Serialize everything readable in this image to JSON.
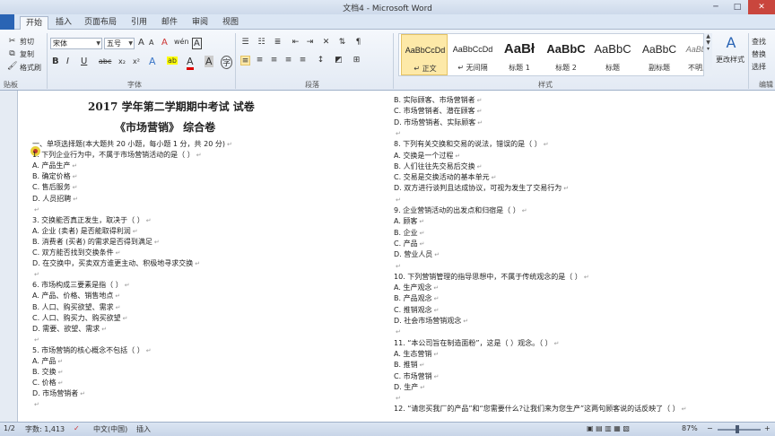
{
  "window": {
    "title": "文档4 - Microsoft Word",
    "minimize": "─",
    "maximize": "□",
    "close": "✕"
  },
  "tabs": [
    "开始",
    "插入",
    "页面布局",
    "引用",
    "邮件",
    "审阅",
    "视图"
  ],
  "clipboard": {
    "cut": "剪切",
    "copy": "复制",
    "format_painter": "格式刷",
    "label": "贴板"
  },
  "font": {
    "name": "宋体",
    "size": "五号",
    "label": "字体",
    "bold": "B",
    "italic": "I",
    "underline": "U",
    "strikethrough": "abc",
    "subscript": "x₂",
    "superscript": "x²",
    "grow": "A",
    "shrink": "A",
    "clear": "A",
    "phonetic": "wén",
    "border_char": "A",
    "highlight": "ab",
    "color": "A",
    "char_shade": "A",
    "circle": "字"
  },
  "paragraph": {
    "label": "段落"
  },
  "styles": {
    "label": "样式",
    "items": [
      {
        "preview": "AaBbCcDd",
        "name": "↵ 正文"
      },
      {
        "preview": "AaBbCcDd",
        "name": "↵ 无间隔"
      },
      {
        "preview": "AaBł",
        "name": "标题 1"
      },
      {
        "preview": "AaBbC",
        "name": "标题 2"
      },
      {
        "preview": "AaBbC",
        "name": "标题"
      },
      {
        "preview": "AaBbC",
        "name": "副标题"
      },
      {
        "preview": "AaBbCcDd",
        "name": "不明显强调"
      }
    ],
    "change_styles": "更改样式"
  },
  "editing": {
    "find": "查找",
    "replace": "替换",
    "select": "选择",
    "label": "编辑"
  },
  "document": {
    "title1": "2017 学年第二学期期中考试  试卷",
    "title2": "《市场营销》  综合卷",
    "left": [
      "一、单项选择题(本大题共 20 小题，每小题 1 分，共 20 分)",
      "1. 下列企业行为中，不属于市场营销活动的是（    ）",
      "A. 产品生产",
      "B. 确定价格",
      "C. 售后服务",
      "D. 人员招聘",
      "",
      "3. 交换能否真正发生，取决于（    ）",
      "A. 企业 (卖者) 是否能取得利润",
      "B. 消费者 (买者) 的需求是否得到满足",
      "C. 双方能否找到交换条件",
      "D. 在交换中，买卖双方谁更主动、积极地寻求交换",
      "",
      "6. 市场构成三要素是指（    ）",
      "A. 产品、价格、销售地点",
      "B. 人口、购买欲望、需求",
      "C. 人口、购买力、购买欲望",
      "D. 需要、欲望、需求",
      "",
      "5. 市场营销的核心概念不包括（    ）",
      "A. 产品",
      "B. 交换",
      "C. 价格",
      "D. 市场营销者",
      ""
    ],
    "right": [
      "B. 实际顾客、市场营销者",
      "C. 市场营销者、潜在顾客",
      "D. 市场营销者、实际顾客",
      "",
      "8. 下列有关交换和交易的说法，错误的是（    ）",
      "A. 交换是一个过程",
      "B. 人们往往先交易后交换",
      "C. 交易是交换活动的基本单元",
      "D. 双方进行谈判且达成协议，可视为发生了交易行为",
      "",
      "9. 企业营销活动的出发点和归宿是（    ）",
      "A. 顾客",
      "B. 企业",
      "C. 产品",
      "D. 营业人员",
      "",
      "10. 下列营销管理的指导思想中，不属于传统观念的是（    ）",
      "A. 生产观念",
      "B. 产品观念",
      "C. 推销观念",
      "D. 社会市场营销观念",
      "",
      "11. “本公司旨在制造面粉”，这是（        ）观念。（    ）",
      "A. 生态营销",
      "B. 推销",
      "C. 市场营销",
      "D. 生产",
      "",
      "12. “请您买我厂的产品”和“您需要什么?让我们来为您生产”这两句顾客说的话反映了（    ）"
    ]
  },
  "status": {
    "page": "1/2",
    "words": "字数: 1,413",
    "language": "中文(中国)",
    "mode": "插入",
    "zoom": "87%",
    "zoom_minus": "−",
    "zoom_plus": "+"
  }
}
